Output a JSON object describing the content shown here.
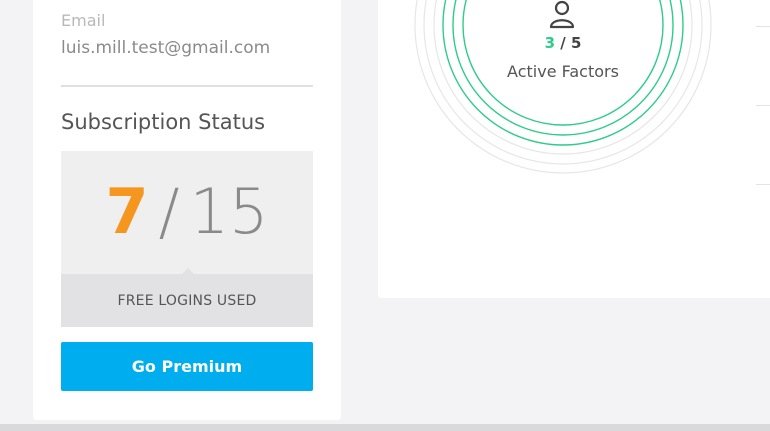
{
  "profile": {
    "email_label": "Email",
    "email_value": "luis.mill.test@gmail.com"
  },
  "subscription": {
    "title": "Subscription Status",
    "used": "7",
    "separator": "/",
    "total": "15",
    "caption": "FREE LOGINS USED",
    "button_label": "Go Premium"
  },
  "factors": {
    "active": "3",
    "separator": " / ",
    "total": "5",
    "label": "Active Factors",
    "icon": "user-icon",
    "ring_color": "#2ecc8a"
  },
  "colors": {
    "accent_orange": "#f5961e",
    "button_blue": "#00aeef",
    "factor_green": "#2ecc8a"
  }
}
